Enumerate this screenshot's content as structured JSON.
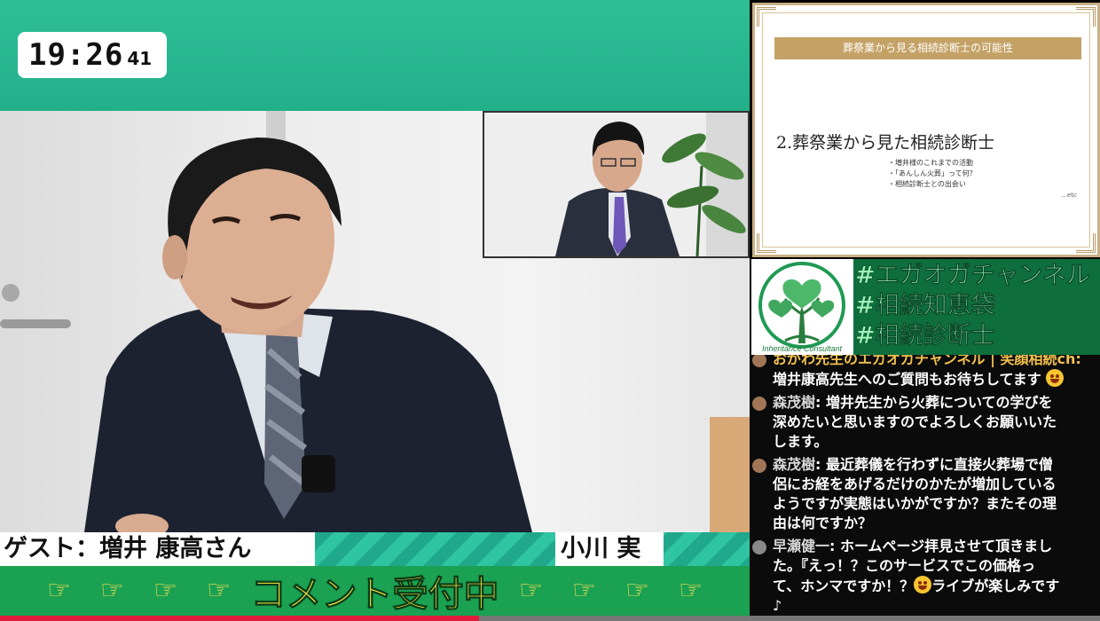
{
  "clock": {
    "hm": "19:26",
    "sec": "41"
  },
  "lower_third": {
    "guest": "ゲスト：増井 康高さん",
    "host": "小川 実",
    "comment_banner": "コメント受付中",
    "hand_glyph": "☞"
  },
  "slide": {
    "header": "葬祭業から見る相続診断士の可能性",
    "title": "2.葬祭業から見た相続診断士",
    "bullets": [
      "・増井様のこれまでの活動",
      "・「あんしん火葬」って何？",
      "・相続診断士との出会い"
    ],
    "etc": "…etc"
  },
  "logo": {
    "text": "Inheritance Consultant",
    "colors": {
      "ring": "#1f9a53",
      "leaf": "#4db86a",
      "trunk": "#2a7d3d"
    }
  },
  "hashtags": [
    "#エガオガチャンネル",
    "#相続知恵袋",
    "#相続診断士"
  ],
  "chat": [
    {
      "author": "おがわ先生のエガオガチャンネル | 笑顔相続ch:",
      "lines": [
        "増井康高先生へのご質問もお待ちしてます"
      ],
      "emoji": "star-struck"
    },
    {
      "author": "森茂樹",
      "lines": [
        ": 増井先生から火葬についての学びを",
        "深めたいと思いますのでよろしくお願いいた",
        "します。"
      ]
    },
    {
      "author": "森茂樹",
      "lines": [
        ": 最近葬儀を行わずに直接火葬場で僧",
        "侶にお経をあげるだけのかたが増加している",
        "ようですが実態はいかがですか？またその理",
        "由は何ですか？"
      ]
    },
    {
      "author": "早瀬健一",
      "lines": [
        ": ホームページ拝見させて頂きまし",
        "た。『えっ！？このサービスでこの価格っ",
        "て、ホンマですか！？",
        "ライブが楽しみです",
        "♪"
      ]
    }
  ],
  "colors": {
    "accent": "#22b08a",
    "banner_green": "#1aa152",
    "banner_text": "#f5e83a",
    "hashtag_bg": "#0e6e3c",
    "hashtag_text": "#9df2b9"
  }
}
